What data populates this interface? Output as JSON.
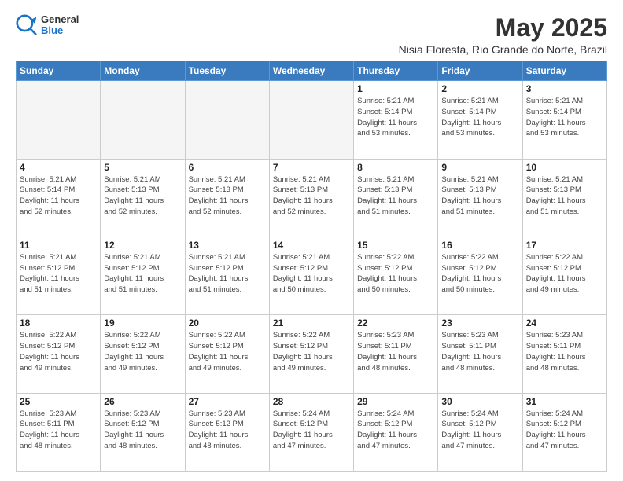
{
  "logo": {
    "general": "General",
    "blue": "Blue"
  },
  "header": {
    "month": "May 2025",
    "location": "Nisia Floresta, Rio Grande do Norte, Brazil"
  },
  "weekdays": [
    "Sunday",
    "Monday",
    "Tuesday",
    "Wednesday",
    "Thursday",
    "Friday",
    "Saturday"
  ],
  "weeks": [
    [
      {
        "day": "",
        "info": ""
      },
      {
        "day": "",
        "info": ""
      },
      {
        "day": "",
        "info": ""
      },
      {
        "day": "",
        "info": ""
      },
      {
        "day": "1",
        "info": "Sunrise: 5:21 AM\nSunset: 5:14 PM\nDaylight: 11 hours\nand 53 minutes."
      },
      {
        "day": "2",
        "info": "Sunrise: 5:21 AM\nSunset: 5:14 PM\nDaylight: 11 hours\nand 53 minutes."
      },
      {
        "day": "3",
        "info": "Sunrise: 5:21 AM\nSunset: 5:14 PM\nDaylight: 11 hours\nand 53 minutes."
      }
    ],
    [
      {
        "day": "4",
        "info": "Sunrise: 5:21 AM\nSunset: 5:14 PM\nDaylight: 11 hours\nand 52 minutes."
      },
      {
        "day": "5",
        "info": "Sunrise: 5:21 AM\nSunset: 5:13 PM\nDaylight: 11 hours\nand 52 minutes."
      },
      {
        "day": "6",
        "info": "Sunrise: 5:21 AM\nSunset: 5:13 PM\nDaylight: 11 hours\nand 52 minutes."
      },
      {
        "day": "7",
        "info": "Sunrise: 5:21 AM\nSunset: 5:13 PM\nDaylight: 11 hours\nand 52 minutes."
      },
      {
        "day": "8",
        "info": "Sunrise: 5:21 AM\nSunset: 5:13 PM\nDaylight: 11 hours\nand 51 minutes."
      },
      {
        "day": "9",
        "info": "Sunrise: 5:21 AM\nSunset: 5:13 PM\nDaylight: 11 hours\nand 51 minutes."
      },
      {
        "day": "10",
        "info": "Sunrise: 5:21 AM\nSunset: 5:13 PM\nDaylight: 11 hours\nand 51 minutes."
      }
    ],
    [
      {
        "day": "11",
        "info": "Sunrise: 5:21 AM\nSunset: 5:12 PM\nDaylight: 11 hours\nand 51 minutes."
      },
      {
        "day": "12",
        "info": "Sunrise: 5:21 AM\nSunset: 5:12 PM\nDaylight: 11 hours\nand 51 minutes."
      },
      {
        "day": "13",
        "info": "Sunrise: 5:21 AM\nSunset: 5:12 PM\nDaylight: 11 hours\nand 51 minutes."
      },
      {
        "day": "14",
        "info": "Sunrise: 5:21 AM\nSunset: 5:12 PM\nDaylight: 11 hours\nand 50 minutes."
      },
      {
        "day": "15",
        "info": "Sunrise: 5:22 AM\nSunset: 5:12 PM\nDaylight: 11 hours\nand 50 minutes."
      },
      {
        "day": "16",
        "info": "Sunrise: 5:22 AM\nSunset: 5:12 PM\nDaylight: 11 hours\nand 50 minutes."
      },
      {
        "day": "17",
        "info": "Sunrise: 5:22 AM\nSunset: 5:12 PM\nDaylight: 11 hours\nand 49 minutes."
      }
    ],
    [
      {
        "day": "18",
        "info": "Sunrise: 5:22 AM\nSunset: 5:12 PM\nDaylight: 11 hours\nand 49 minutes."
      },
      {
        "day": "19",
        "info": "Sunrise: 5:22 AM\nSunset: 5:12 PM\nDaylight: 11 hours\nand 49 minutes."
      },
      {
        "day": "20",
        "info": "Sunrise: 5:22 AM\nSunset: 5:12 PM\nDaylight: 11 hours\nand 49 minutes."
      },
      {
        "day": "21",
        "info": "Sunrise: 5:22 AM\nSunset: 5:12 PM\nDaylight: 11 hours\nand 49 minutes."
      },
      {
        "day": "22",
        "info": "Sunrise: 5:23 AM\nSunset: 5:11 PM\nDaylight: 11 hours\nand 48 minutes."
      },
      {
        "day": "23",
        "info": "Sunrise: 5:23 AM\nSunset: 5:11 PM\nDaylight: 11 hours\nand 48 minutes."
      },
      {
        "day": "24",
        "info": "Sunrise: 5:23 AM\nSunset: 5:11 PM\nDaylight: 11 hours\nand 48 minutes."
      }
    ],
    [
      {
        "day": "25",
        "info": "Sunrise: 5:23 AM\nSunset: 5:11 PM\nDaylight: 11 hours\nand 48 minutes."
      },
      {
        "day": "26",
        "info": "Sunrise: 5:23 AM\nSunset: 5:12 PM\nDaylight: 11 hours\nand 48 minutes."
      },
      {
        "day": "27",
        "info": "Sunrise: 5:23 AM\nSunset: 5:12 PM\nDaylight: 11 hours\nand 48 minutes."
      },
      {
        "day": "28",
        "info": "Sunrise: 5:24 AM\nSunset: 5:12 PM\nDaylight: 11 hours\nand 47 minutes."
      },
      {
        "day": "29",
        "info": "Sunrise: 5:24 AM\nSunset: 5:12 PM\nDaylight: 11 hours\nand 47 minutes."
      },
      {
        "day": "30",
        "info": "Sunrise: 5:24 AM\nSunset: 5:12 PM\nDaylight: 11 hours\nand 47 minutes."
      },
      {
        "day": "31",
        "info": "Sunrise: 5:24 AM\nSunset: 5:12 PM\nDaylight: 11 hours\nand 47 minutes."
      }
    ]
  ]
}
